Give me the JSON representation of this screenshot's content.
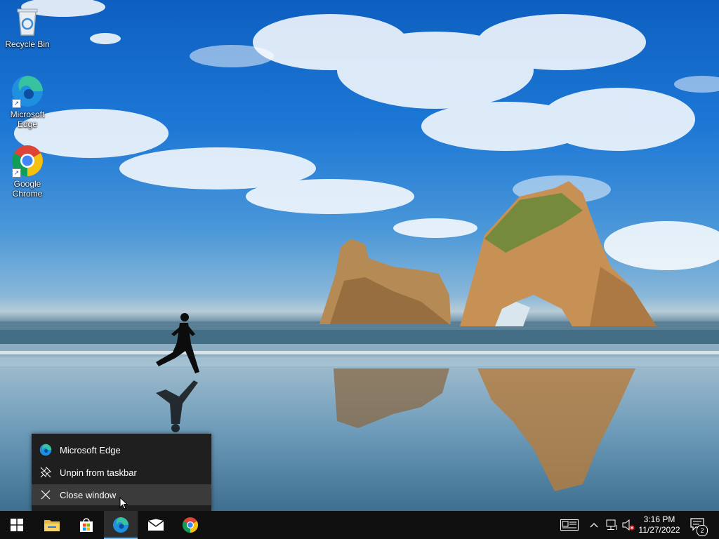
{
  "desktop": {
    "icons": [
      {
        "label": "Recycle Bin",
        "icon": "recycle-bin-icon"
      },
      {
        "label": "Microsoft Edge",
        "icon": "edge-icon"
      },
      {
        "label": "Google Chrome",
        "icon": "chrome-icon"
      }
    ]
  },
  "jumplist": {
    "items": [
      {
        "label": "Microsoft Edge",
        "icon": "edge-icon"
      },
      {
        "label": "Unpin from taskbar",
        "icon": "unpin-icon"
      },
      {
        "label": "Close window",
        "icon": "close-icon"
      }
    ]
  },
  "taskbar": {
    "apps": [
      {
        "name": "Start",
        "icon": "windows-start-icon"
      },
      {
        "name": "File Explorer",
        "icon": "folder-icon"
      },
      {
        "name": "Microsoft Store",
        "icon": "store-icon"
      },
      {
        "name": "Microsoft Edge",
        "icon": "edge-icon",
        "active": true
      },
      {
        "name": "Mail",
        "icon": "mail-icon"
      },
      {
        "name": "Google Chrome",
        "icon": "chrome-icon"
      }
    ],
    "tray": {
      "time": "3:16 PM",
      "date": "11/27/2022",
      "notification_count": "2"
    }
  },
  "colors": {
    "taskbar_bg": "#101010",
    "menu_bg": "#1f1f1f",
    "menu_hover": "#3b3b3b",
    "accent": "#76b9ed"
  }
}
